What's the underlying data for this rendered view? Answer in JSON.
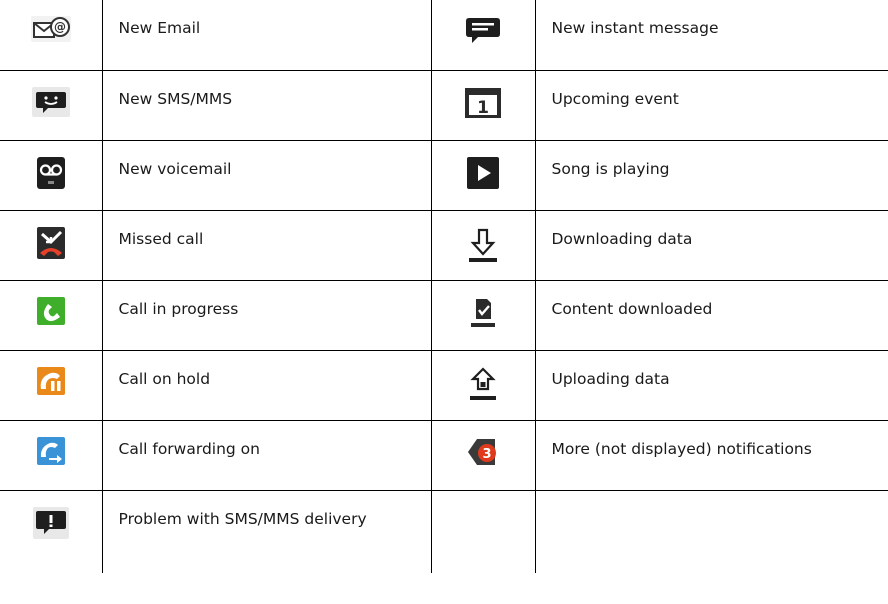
{
  "rows": [
    {
      "left": {
        "icon": "email-icon",
        "label": "New Email"
      },
      "right": {
        "icon": "instant-message-icon",
        "label": "New instant message"
      }
    },
    {
      "left": {
        "icon": "sms-icon",
        "label": "New SMS/MMS"
      },
      "right": {
        "icon": "calendar-icon",
        "label": "Upcoming event"
      }
    },
    {
      "left": {
        "icon": "voicemail-icon",
        "label": "New voicemail"
      },
      "right": {
        "icon": "play-icon",
        "label": "Song is playing"
      }
    },
    {
      "left": {
        "icon": "missed-call-icon",
        "label": "Missed call"
      },
      "right": {
        "icon": "download-icon",
        "label": "Downloading data"
      }
    },
    {
      "left": {
        "icon": "call-in-progress-icon",
        "label": "Call in progress"
      },
      "right": {
        "icon": "content-downloaded-icon",
        "label": "Content downloaded"
      }
    },
    {
      "left": {
        "icon": "call-on-hold-icon",
        "label": "Call on hold"
      },
      "right": {
        "icon": "upload-icon",
        "label": "Uploading data"
      }
    },
    {
      "left": {
        "icon": "call-forwarding-icon",
        "label": "Call forwarding on"
      },
      "right": {
        "icon": "more-notifications-icon",
        "label": "More (not displayed) notifications"
      }
    },
    {
      "left": {
        "icon": "sms-problem-icon",
        "label": "Problem with SMS/MMS delivery"
      },
      "right": {
        "icon": "",
        "label": ""
      }
    }
  ],
  "colors": {
    "icon_dark": "#1e1e1e",
    "missed_red": "#e8412a",
    "call_green": "#3fae2a",
    "hold_orange": "#e8891a",
    "forward_blue": "#3a93d6",
    "badge_red": "#e03a1c"
  }
}
